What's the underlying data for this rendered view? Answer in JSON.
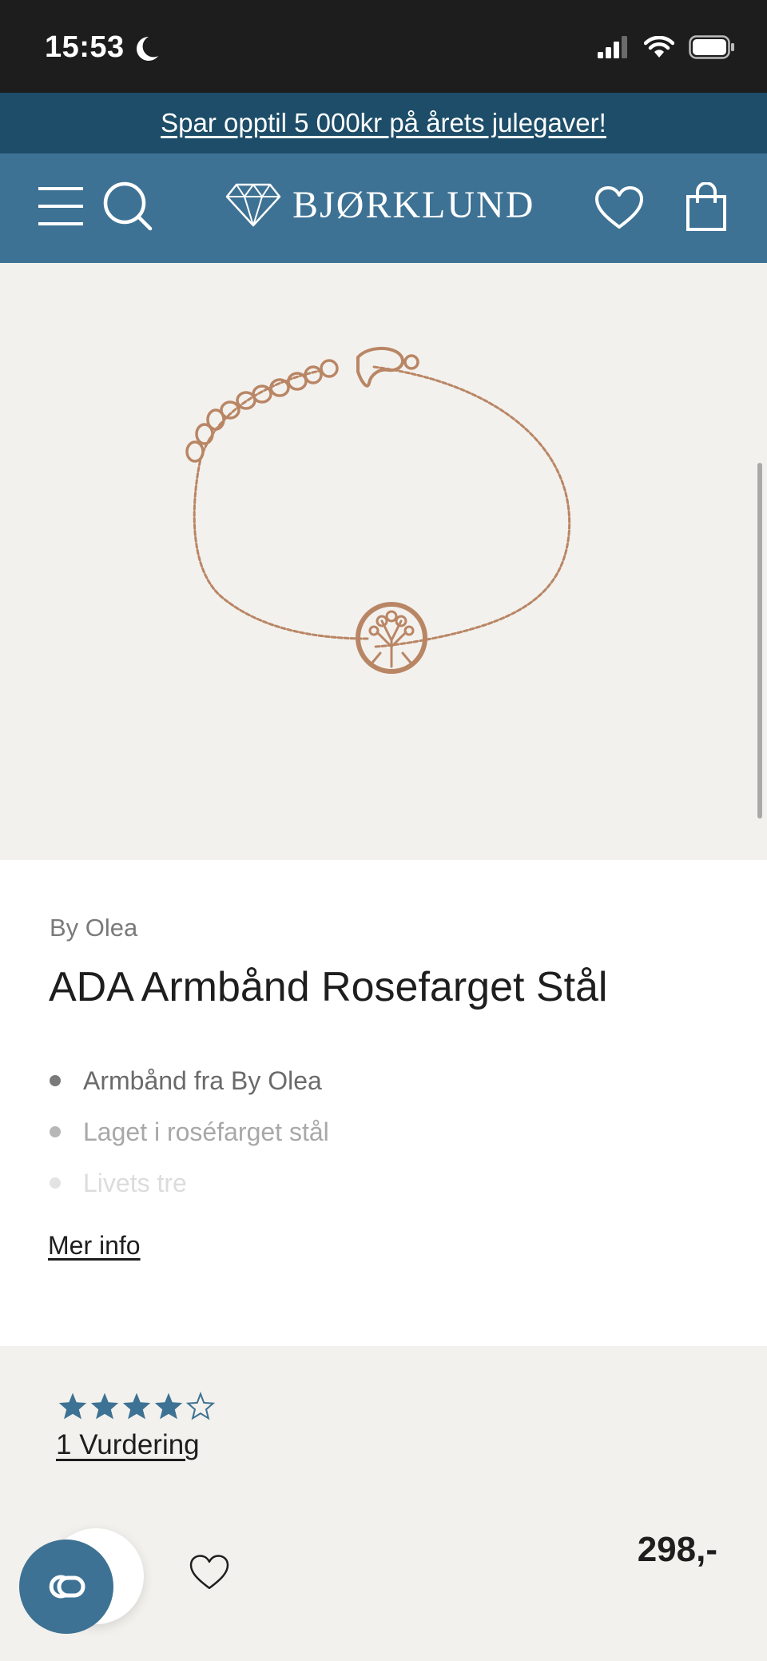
{
  "status_bar": {
    "time": "15:53"
  },
  "promo": {
    "text": "Spar opptil 5 000kr på årets julegaver!"
  },
  "header": {
    "logo_text": "BJØRKLUND"
  },
  "product": {
    "brand": "By Olea",
    "title": "ADA Armbånd Rosefarget Stål",
    "features": [
      "Armbånd fra By Olea",
      "Laget i roséfarget stål",
      "Livets tre"
    ],
    "more_info": "Mer info",
    "rating_value": 4,
    "rating_max": 5,
    "rating_link": "1 Vurdering",
    "price": "298,-"
  },
  "colors": {
    "header": "#3e7294",
    "promo": "#1d4d68",
    "image_bg": "#f3f1ed",
    "accent": "#3e7294"
  }
}
